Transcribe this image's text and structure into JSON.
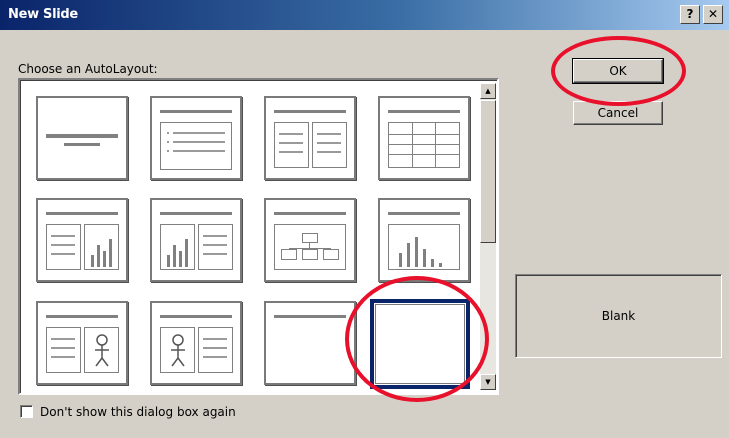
{
  "dialog": {
    "title": "New Slide",
    "help_glyph": "?",
    "close_glyph": "✕"
  },
  "layouts_label": "Choose an AutoLayout:",
  "layouts": [
    "Title Slide",
    "Bulleted List",
    "2 Column Text",
    "Table",
    "Text & Chart",
    "Chart & Text",
    "Organization Chart",
    "Chart",
    "Text & Clip Art",
    "Clip Art & Text",
    "Title Only",
    "Blank"
  ],
  "selected_layout": "Blank",
  "buttons": {
    "ok": "OK",
    "cancel": "Cancel"
  },
  "preview_label": "Blank",
  "checkbox": {
    "label": "Don't show this dialog box again",
    "checked": false
  },
  "scrollbar": {
    "up_glyph": "▲",
    "down_glyph": "▼"
  },
  "colors": {
    "annotation": "#e8102a",
    "selection": "#0a246a"
  }
}
